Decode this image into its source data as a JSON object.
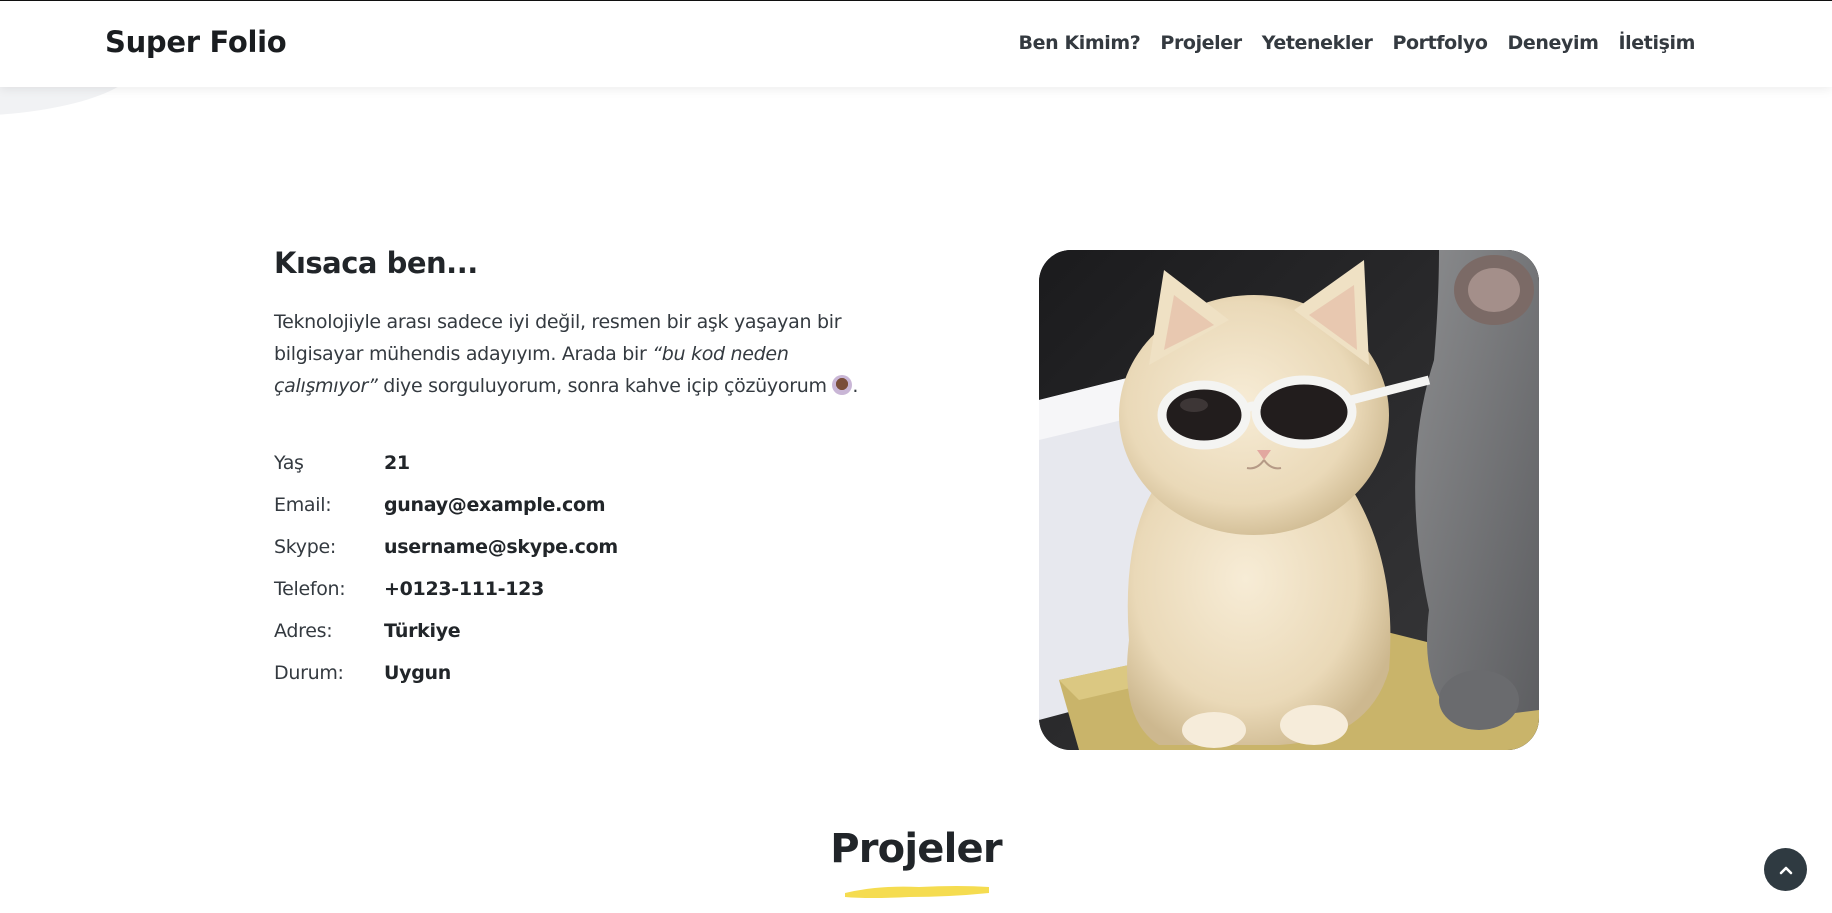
{
  "header": {
    "brand": "Super Folio",
    "nav": [
      "Ben Kimim?",
      "Projeler",
      "Yetenekler",
      "Portfolyo",
      "Deneyim",
      "İletişim"
    ]
  },
  "about": {
    "title": "Kısaca ben...",
    "text_part1": "Teknolojiyle arası sadece iyi değil, resmen bir aşk yaşayan bir bilgisayar mühendis adayıyım. Arada bir ",
    "text_quote": "“bu kod neden çalışmıyor”",
    "text_part2": " diye sorguluyorum, sonra kahve içip çözüyorum ",
    "text_end": ".",
    "text_icon": "coffee-icon",
    "info": [
      {
        "label": "Yaş",
        "value": "21"
      },
      {
        "label": "Email:",
        "value": "gunay@example.com"
      },
      {
        "label": "Skype:",
        "value": "username@skype.com"
      },
      {
        "label": "Telefon:",
        "value": "+0123-111-123"
      },
      {
        "label": "Adres:",
        "value": "Türkiye"
      },
      {
        "label": "Durum:",
        "value": "Uygun"
      }
    ],
    "photo_icon": "cat-with-sunglasses-photo"
  },
  "projects": {
    "title": "Projeler",
    "underline_color": "#f5dc50"
  },
  "scroll_top": {
    "icon": "chevron-up-icon"
  },
  "colors": {
    "text": "#212529",
    "scroll_button": "#2f3a41"
  }
}
